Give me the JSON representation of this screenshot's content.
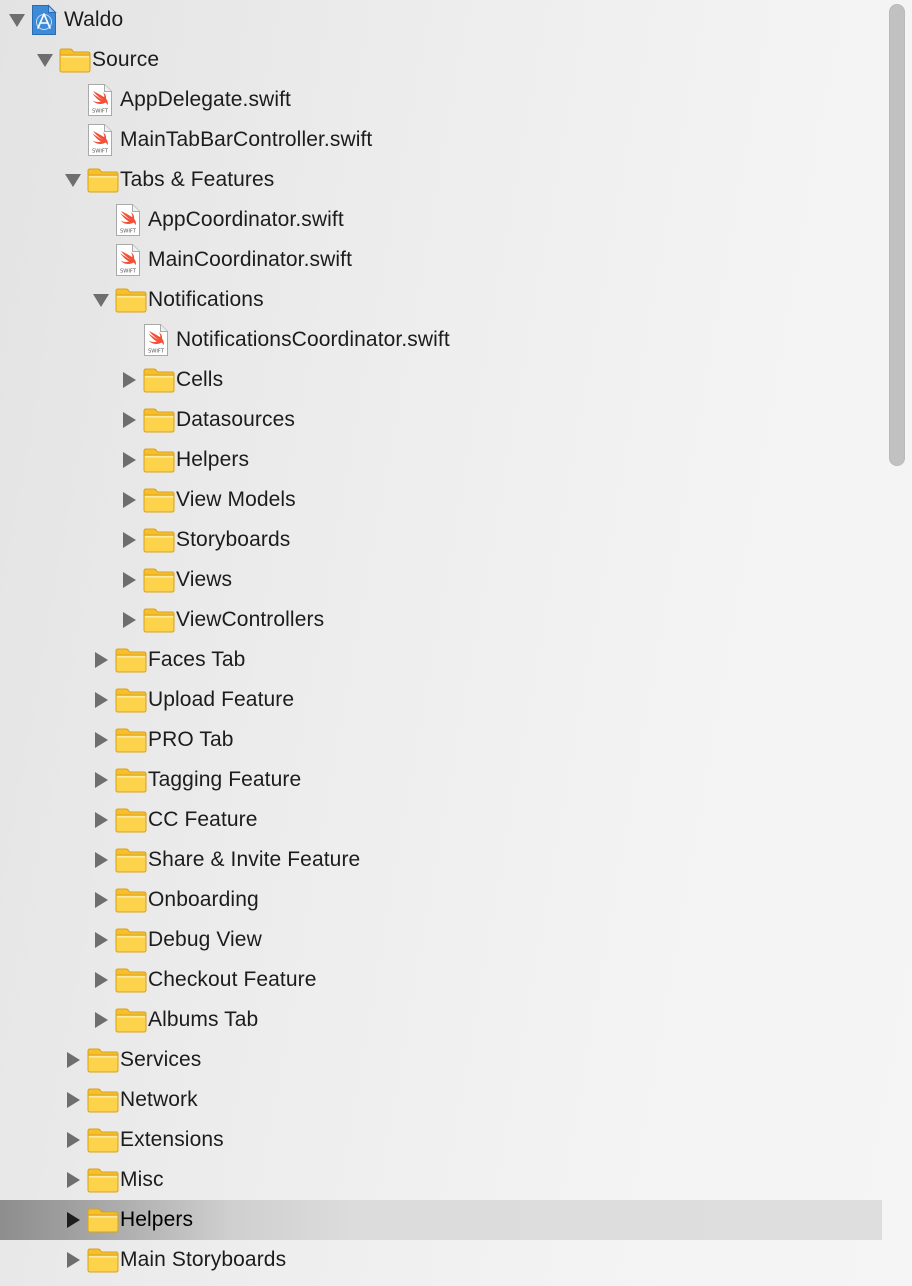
{
  "navigator": {
    "rows": [
      {
        "label": "Waldo",
        "kind": "project",
        "depth": 0,
        "state": "expanded",
        "icon": "xcode-project-icon"
      },
      {
        "label": "Source",
        "kind": "folder",
        "depth": 1,
        "state": "expanded",
        "icon": "folder-icon"
      },
      {
        "label": "AppDelegate.swift",
        "kind": "swift",
        "depth": 2,
        "state": "none",
        "icon": "swift-file-icon"
      },
      {
        "label": "MainTabBarController.swift",
        "kind": "swift",
        "depth": 2,
        "state": "none",
        "icon": "swift-file-icon"
      },
      {
        "label": "Tabs & Features",
        "kind": "folder",
        "depth": 2,
        "state": "expanded",
        "icon": "folder-icon"
      },
      {
        "label": "AppCoordinator.swift",
        "kind": "swift",
        "depth": 3,
        "state": "none",
        "icon": "swift-file-icon"
      },
      {
        "label": "MainCoordinator.swift",
        "kind": "swift",
        "depth": 3,
        "state": "none",
        "icon": "swift-file-icon"
      },
      {
        "label": "Notifications",
        "kind": "folder",
        "depth": 3,
        "state": "expanded",
        "icon": "folder-icon"
      },
      {
        "label": "NotificationsCoordinator.swift",
        "kind": "swift",
        "depth": 4,
        "state": "none",
        "icon": "swift-file-icon"
      },
      {
        "label": "Cells",
        "kind": "folder",
        "depth": 4,
        "state": "collapsed",
        "icon": "folder-icon"
      },
      {
        "label": "Datasources",
        "kind": "folder",
        "depth": 4,
        "state": "collapsed",
        "icon": "folder-icon"
      },
      {
        "label": "Helpers",
        "kind": "folder",
        "depth": 4,
        "state": "collapsed",
        "icon": "folder-icon"
      },
      {
        "label": "View Models",
        "kind": "folder",
        "depth": 4,
        "state": "collapsed",
        "icon": "folder-icon"
      },
      {
        "label": "Storyboards",
        "kind": "folder",
        "depth": 4,
        "state": "collapsed",
        "icon": "folder-icon"
      },
      {
        "label": "Views",
        "kind": "folder",
        "depth": 4,
        "state": "collapsed",
        "icon": "folder-icon"
      },
      {
        "label": "ViewControllers",
        "kind": "folder",
        "depth": 4,
        "state": "collapsed",
        "icon": "folder-icon"
      },
      {
        "label": "Faces Tab",
        "kind": "folder",
        "depth": 3,
        "state": "collapsed",
        "icon": "folder-icon"
      },
      {
        "label": "Upload Feature",
        "kind": "folder",
        "depth": 3,
        "state": "collapsed",
        "icon": "folder-icon"
      },
      {
        "label": "PRO Tab",
        "kind": "folder",
        "depth": 3,
        "state": "collapsed",
        "icon": "folder-icon"
      },
      {
        "label": "Tagging Feature",
        "kind": "folder",
        "depth": 3,
        "state": "collapsed",
        "icon": "folder-icon"
      },
      {
        "label": "CC Feature",
        "kind": "folder",
        "depth": 3,
        "state": "collapsed",
        "icon": "folder-icon"
      },
      {
        "label": "Share & Invite Feature",
        "kind": "folder",
        "depth": 3,
        "state": "collapsed",
        "icon": "folder-icon"
      },
      {
        "label": "Onboarding",
        "kind": "folder",
        "depth": 3,
        "state": "collapsed",
        "icon": "folder-icon"
      },
      {
        "label": "Debug View",
        "kind": "folder",
        "depth": 3,
        "state": "collapsed",
        "icon": "folder-icon"
      },
      {
        "label": "Checkout Feature",
        "kind": "folder",
        "depth": 3,
        "state": "collapsed",
        "icon": "folder-icon"
      },
      {
        "label": "Albums Tab",
        "kind": "folder",
        "depth": 3,
        "state": "collapsed",
        "icon": "folder-icon"
      },
      {
        "label": "Services",
        "kind": "folder",
        "depth": 2,
        "state": "collapsed",
        "icon": "folder-icon"
      },
      {
        "label": "Network",
        "kind": "folder",
        "depth": 2,
        "state": "collapsed",
        "icon": "folder-icon"
      },
      {
        "label": "Extensions",
        "kind": "folder",
        "depth": 2,
        "state": "collapsed",
        "icon": "folder-icon"
      },
      {
        "label": "Misc",
        "kind": "folder",
        "depth": 2,
        "state": "collapsed",
        "icon": "folder-icon"
      },
      {
        "label": "Helpers",
        "kind": "folder",
        "depth": 2,
        "state": "collapsed",
        "icon": "folder-icon",
        "selected": true
      },
      {
        "label": "Main Storyboards",
        "kind": "folder",
        "depth": 2,
        "state": "collapsed",
        "icon": "folder-icon"
      }
    ],
    "swift_badge": "SWIFT"
  },
  "colors": {
    "folder_body": "#fcd34a",
    "folder_tab": "#f6bf2b",
    "folder_outline": "#d9a21c",
    "swift_orange": "#f05138",
    "project_blue": "#3d8bd8",
    "selected_row": "#dcdcdc",
    "disclosure": "#6e6e6e",
    "scroll_thumb": "#c1c1c1"
  }
}
